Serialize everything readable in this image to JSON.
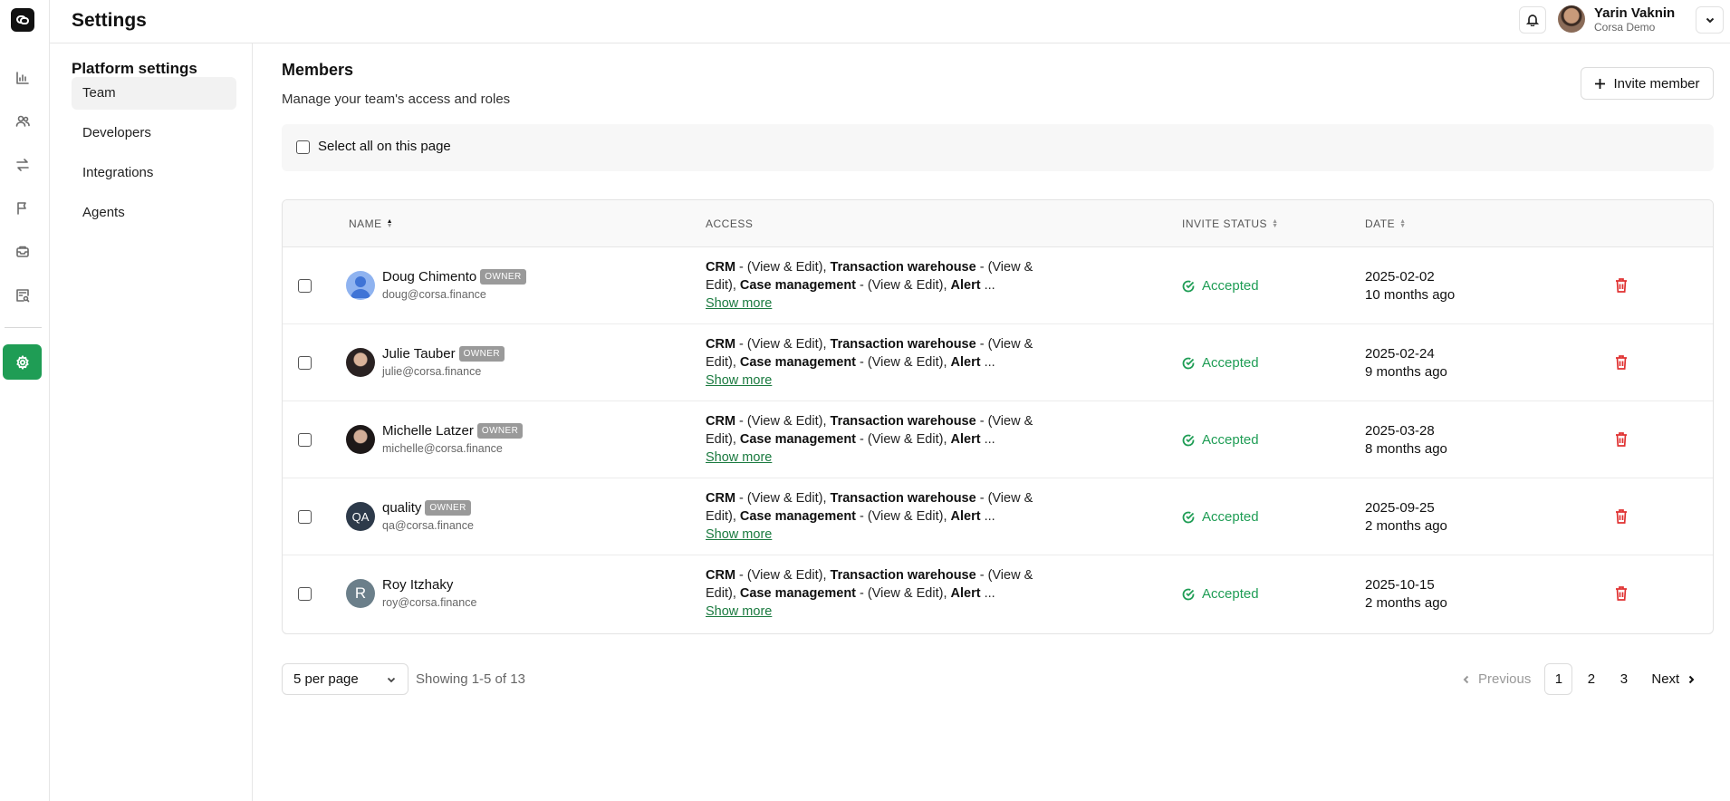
{
  "header": {
    "title": "Settings",
    "user_name": "Yarin Vaknin",
    "user_org": "Corsa Demo"
  },
  "rail": {
    "icons": [
      "logo-icon",
      "chart-icon",
      "users-icon",
      "transfer-icon",
      "flag-icon",
      "inbox-icon",
      "report-search-icon",
      "settings-icon"
    ]
  },
  "settings_nav": {
    "heading": "Platform settings",
    "items": [
      {
        "label": "Team",
        "selected": true
      },
      {
        "label": "Developers",
        "selected": false
      },
      {
        "label": "Integrations",
        "selected": false
      },
      {
        "label": "Agents",
        "selected": false
      }
    ]
  },
  "members": {
    "title": "Members",
    "subtitle": "Manage your team's access and roles",
    "invite_label": "Invite member",
    "select_all_label": "Select all on this page"
  },
  "table": {
    "headers": {
      "name": "NAME",
      "access": "ACCESS",
      "invite_status": "INVITE STATUS",
      "date": "DATE"
    },
    "access_parts": {
      "crm": "CRM",
      "crm_perm": " - (View & Edit), ",
      "tw": "Transaction warehouse",
      "tw_perm": " - (View & Edit), ",
      "cm": "Case management",
      "cm_perm": " - (View & Edit), ",
      "alert": "Alert",
      "ellipsis": " ...",
      "show_more": "Show more"
    },
    "rows": [
      {
        "name": "Doug Chimento",
        "badge": "OWNER",
        "email": "doug@corsa.finance",
        "status": "Accepted",
        "date": "2025-02-02",
        "ago": "10 months ago",
        "avatar": "default",
        "initials": ""
      },
      {
        "name": "Julie Tauber",
        "badge": "OWNER",
        "email": "julie@corsa.finance",
        "status": "Accepted",
        "date": "2025-02-24",
        "ago": "9 months ago",
        "avatar": "photo1",
        "initials": ""
      },
      {
        "name": "Michelle Latzer",
        "badge": "OWNER",
        "email": "michelle@corsa.finance",
        "status": "Accepted",
        "date": "2025-03-28",
        "ago": "8 months ago",
        "avatar": "photo2",
        "initials": ""
      },
      {
        "name": "quality",
        "badge": "OWNER",
        "email": "qa@corsa.finance",
        "status": "Accepted",
        "date": "2025-09-25",
        "ago": "2 months ago",
        "avatar": "qa",
        "initials": "QA"
      },
      {
        "name": "Roy Itzhaky",
        "badge": "",
        "email": "roy@corsa.finance",
        "status": "Accepted",
        "date": "2025-10-15",
        "ago": "2 months ago",
        "avatar": "r",
        "initials": "R"
      }
    ]
  },
  "pagination": {
    "per_page": "5 per page",
    "showing": "Showing 1-5 of 13",
    "previous": "Previous",
    "next": "Next",
    "pages": [
      "1",
      "2",
      "3"
    ],
    "current": "1"
  },
  "colors": {
    "accent": "#1f9d55",
    "danger": "#e03131"
  }
}
